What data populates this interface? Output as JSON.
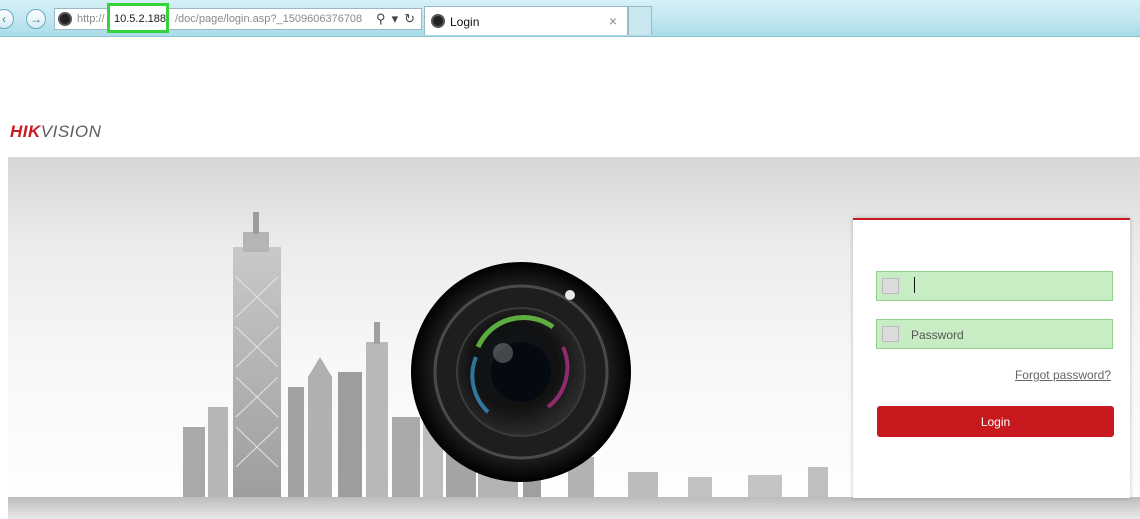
{
  "browser": {
    "url_prefix": "http://",
    "url_host": "10.5.2.188",
    "url_path": "/doc/page/login.asp?_1509606376708",
    "tab_title": "Login",
    "tab_close": "×",
    "search_glyph": "⚲",
    "dropdown_glyph": "▾",
    "refresh_glyph": "↻"
  },
  "logo": {
    "hik": "HIK",
    "vision": "VISION"
  },
  "login": {
    "username_value": "",
    "password_placeholder": "Password",
    "forgot_label": "Forgot password?",
    "login_label": "Login"
  },
  "colors": {
    "brand": "#c8191f",
    "field_bg": "#c8ecc4",
    "highlight": "#35d43a"
  }
}
